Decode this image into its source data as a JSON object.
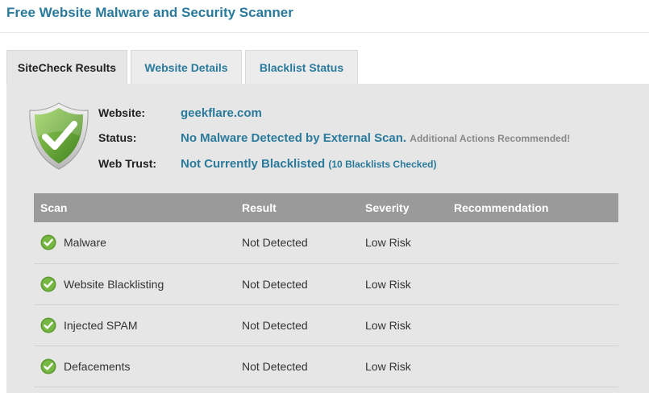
{
  "page": {
    "title": "Free Website Malware and Security Scanner"
  },
  "tabs": [
    {
      "label": "SiteCheck Results",
      "active": true
    },
    {
      "label": "Website Details",
      "active": false
    },
    {
      "label": "Blacklist Status",
      "active": false
    }
  ],
  "summary": {
    "shield_icon": "shield-check-icon",
    "website_label": "Website:",
    "website_value": "geekflare.com",
    "status_label": "Status:",
    "status_value": "No Malware Detected by External Scan.",
    "status_note": "Additional Actions Recommended!",
    "trust_label": "Web Trust:",
    "trust_value": "Not Currently Blacklisted",
    "trust_note": "(10 Blacklists Checked)"
  },
  "table": {
    "headers": [
      "Scan",
      "Result",
      "Severity",
      "Recommendation"
    ],
    "rows": [
      {
        "scan": "Malware",
        "result": "Not Detected",
        "severity": "Low Risk",
        "recommendation": ""
      },
      {
        "scan": "Website Blacklisting",
        "result": "Not Detected",
        "severity": "Low Risk",
        "recommendation": ""
      },
      {
        "scan": "Injected SPAM",
        "result": "Not Detected",
        "severity": "Low Risk",
        "recommendation": ""
      },
      {
        "scan": "Defacements",
        "result": "Not Detected",
        "severity": "Low Risk",
        "recommendation": ""
      }
    ]
  },
  "colors": {
    "accent": "#2a7a9c",
    "success": "#6aa63a",
    "panel": "#e6e6e6",
    "table_header": "#9a9a9a"
  }
}
